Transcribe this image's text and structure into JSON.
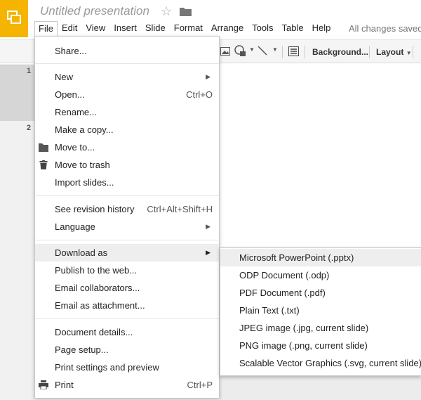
{
  "header": {
    "title": "Untitled presentation",
    "status": "All changes saved"
  },
  "menubar": [
    "File",
    "Edit",
    "View",
    "Insert",
    "Slide",
    "Format",
    "Arrange",
    "Tools",
    "Table",
    "Help"
  ],
  "toolbar": {
    "background_label": "Background...",
    "layout_label": "Layout"
  },
  "filmstrip": {
    "slide_numbers": [
      "1",
      "2"
    ]
  },
  "file_menu": {
    "share": "Share...",
    "new": "New",
    "open": "Open...",
    "open_shortcut": "Ctrl+O",
    "rename": "Rename...",
    "make_copy": "Make a copy...",
    "move_to": "Move to...",
    "move_to_trash": "Move to trash",
    "import_slides": "Import slides...",
    "revision_history": "See revision history",
    "revision_shortcut": "Ctrl+Alt+Shift+H",
    "language": "Language",
    "download_as": "Download as",
    "publish": "Publish to the web...",
    "email_collaborators": "Email collaborators...",
    "email_attachment": "Email as attachment...",
    "document_details": "Document details...",
    "page_setup": "Page setup...",
    "print_settings": "Print settings and preview",
    "print": "Print",
    "print_shortcut": "Ctrl+P"
  },
  "download_submenu": [
    "Microsoft PowerPoint (.pptx)",
    "ODP Document (.odp)",
    "PDF Document (.pdf)",
    "Plain Text (.txt)",
    "JPEG image (.jpg, current slide)",
    "PNG image (.png, current slide)",
    "Scalable Vector Graphics (.svg, current slide)"
  ],
  "colors": {
    "logo": "#f4b400",
    "highlight": "#eeeeee"
  }
}
